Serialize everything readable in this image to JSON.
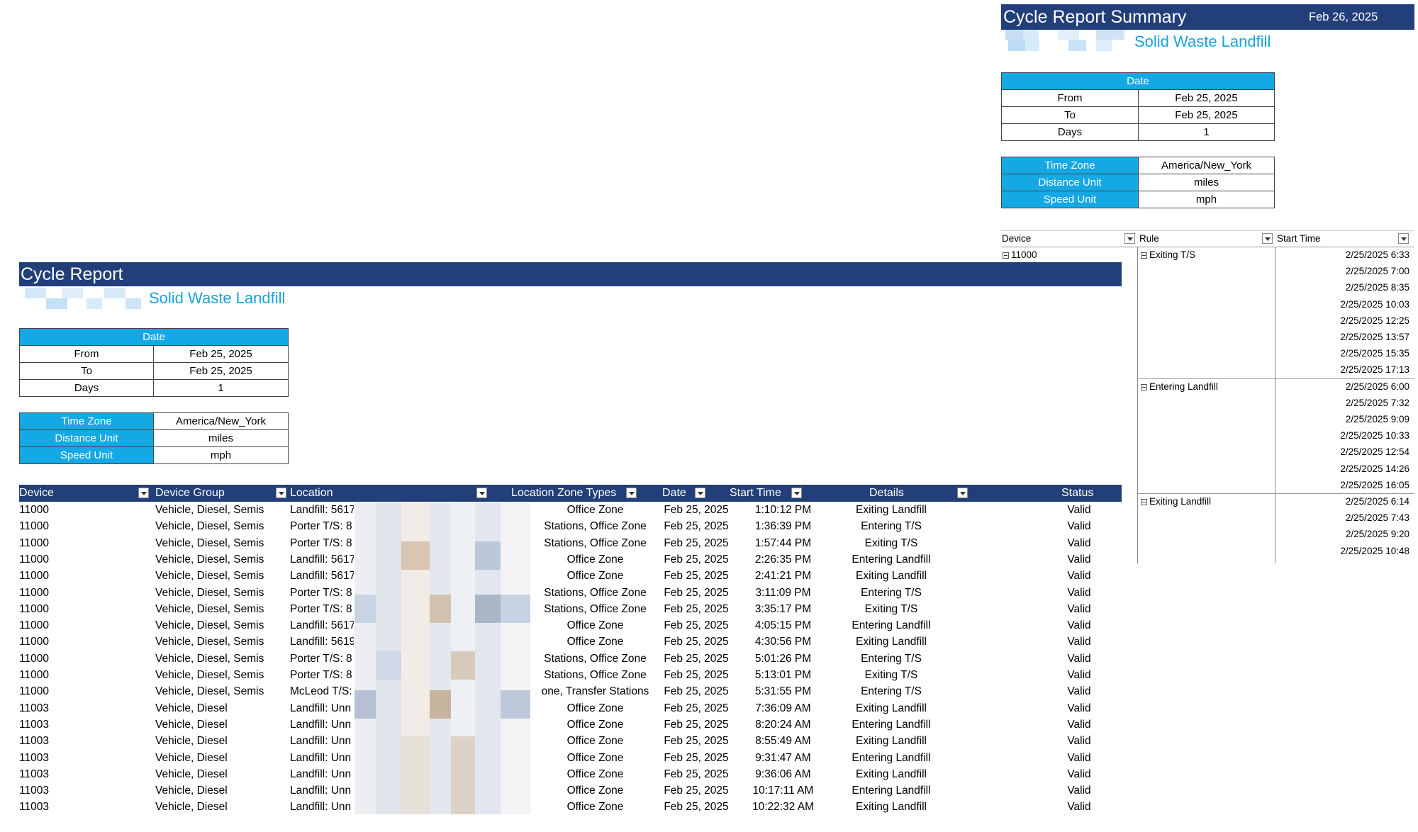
{
  "summary": {
    "title": "Cycle Report Summary",
    "date": "Feb 26, 2025",
    "subtitle": "Solid Waste Landfill",
    "date_header": "Date",
    "from_label": "From",
    "from_value": "Feb 25, 2025",
    "to_label": "To",
    "to_value": "Feb 25, 2025",
    "days_label": "Days",
    "days_value": "1",
    "tz_label": "Time Zone",
    "tz_value": "America/New_York",
    "dist_label": "Distance Unit",
    "dist_value": "miles",
    "speed_label": "Speed Unit",
    "speed_value": "mph"
  },
  "report": {
    "title": "Cycle Report",
    "subtitle": "Solid Waste Landfill",
    "date_header": "Date",
    "from_label": "From",
    "from_value": "Feb 25, 2025",
    "to_label": "To",
    "to_value": "Feb 25, 2025",
    "days_label": "Days",
    "days_value": "1",
    "tz_label": "Time Zone",
    "tz_value": "America/New_York",
    "dist_label": "Distance Unit",
    "dist_value": "miles",
    "speed_label": "Speed Unit",
    "speed_value": "mph"
  },
  "table": {
    "headers": [
      "Device",
      "Device Group",
      "Location",
      "Location Zone Types",
      "Date",
      "Start Time",
      "Details",
      "Status"
    ],
    "rows": [
      [
        "11000",
        "Vehicle, Diesel, Semis",
        "Landfill: 5617",
        "Office Zone",
        "Feb 25, 2025",
        "1:10:12 PM",
        "Exiting Landfill",
        "Valid"
      ],
      [
        "11000",
        "Vehicle, Diesel, Semis",
        "Porter T/S: 8",
        "Stations, Office Zone",
        "Feb 25, 2025",
        "1:36:39 PM",
        "Entering T/S",
        "Valid"
      ],
      [
        "11000",
        "Vehicle, Diesel, Semis",
        "Porter T/S: 8",
        "Stations, Office Zone",
        "Feb 25, 2025",
        "1:57:44 PM",
        "Exiting T/S",
        "Valid"
      ],
      [
        "11000",
        "Vehicle, Diesel, Semis",
        "Landfill: 5617",
        "Office Zone",
        "Feb 25, 2025",
        "2:26:35 PM",
        "Entering Landfill",
        "Valid"
      ],
      [
        "11000",
        "Vehicle, Diesel, Semis",
        "Landfill: 5617",
        "Office Zone",
        "Feb 25, 2025",
        "2:41:21 PM",
        "Exiting Landfill",
        "Valid"
      ],
      [
        "11000",
        "Vehicle, Diesel, Semis",
        "Porter T/S: 8",
        "Stations, Office Zone",
        "Feb 25, 2025",
        "3:11:09 PM",
        "Entering T/S",
        "Valid"
      ],
      [
        "11000",
        "Vehicle, Diesel, Semis",
        "Porter T/S: 8",
        "Stations, Office Zone",
        "Feb 25, 2025",
        "3:35:17 PM",
        "Exiting T/S",
        "Valid"
      ],
      [
        "11000",
        "Vehicle, Diesel, Semis",
        "Landfill: 5617",
        "Office Zone",
        "Feb 25, 2025",
        "4:05:15 PM",
        "Entering Landfill",
        "Valid"
      ],
      [
        "11000",
        "Vehicle, Diesel, Semis",
        "Landfill: 5619",
        "Office Zone",
        "Feb 25, 2025",
        "4:30:56 PM",
        "Exiting Landfill",
        "Valid"
      ],
      [
        "11000",
        "Vehicle, Diesel, Semis",
        "Porter T/S: 8",
        "Stations, Office Zone",
        "Feb 25, 2025",
        "5:01:26 PM",
        "Entering T/S",
        "Valid"
      ],
      [
        "11000",
        "Vehicle, Diesel, Semis",
        "Porter T/S: 8",
        "Stations, Office Zone",
        "Feb 25, 2025",
        "5:13:01 PM",
        "Exiting T/S",
        "Valid"
      ],
      [
        "11000",
        "Vehicle, Diesel, Semis",
        "McLeod T/S:",
        "one, Transfer Stations",
        "Feb 25, 2025",
        "5:31:55 PM",
        "Entering T/S",
        "Valid"
      ],
      [
        "11003",
        "Vehicle, Diesel",
        "Landfill: Unn",
        "Office Zone",
        "Feb 25, 2025",
        "7:36:09 AM",
        "Exiting Landfill",
        "Valid"
      ],
      [
        "11003",
        "Vehicle, Diesel",
        "Landfill: Unn",
        "Office Zone",
        "Feb 25, 2025",
        "8:20:24 AM",
        "Entering Landfill",
        "Valid"
      ],
      [
        "11003",
        "Vehicle, Diesel",
        "Landfill: Unn",
        "Office Zone",
        "Feb 25, 2025",
        "8:55:49 AM",
        "Exiting Landfill",
        "Valid"
      ],
      [
        "11003",
        "Vehicle, Diesel",
        "Landfill: Unn",
        "Office Zone",
        "Feb 25, 2025",
        "9:31:47 AM",
        "Entering Landfill",
        "Valid"
      ],
      [
        "11003",
        "Vehicle, Diesel",
        "Landfill: Unn",
        "Office Zone",
        "Feb 25, 2025",
        "9:36:06 AM",
        "Exiting Landfill",
        "Valid"
      ],
      [
        "11003",
        "Vehicle, Diesel",
        "Landfill: Unn",
        "Office Zone",
        "Feb 25, 2025",
        "10:17:11 AM",
        "Entering Landfill",
        "Valid"
      ],
      [
        "11003",
        "Vehicle, Diesel",
        "Landfill: Unn",
        "Office Zone",
        "Feb 25, 2025",
        "10:22:32 AM",
        "Exiting Landfill",
        "Valid"
      ]
    ]
  },
  "pivot": {
    "headers": [
      "Device",
      "Rule",
      "Start Time"
    ],
    "device": "11000",
    "groups": [
      {
        "rule": "Exiting T/S",
        "times": [
          "2/25/2025 6:33",
          "2/25/2025 7:00",
          "2/25/2025 8:35",
          "2/25/2025 10:03",
          "2/25/2025 12:25",
          "2/25/2025 13:57",
          "2/25/2025 15:35",
          "2/25/2025 17:13"
        ]
      },
      {
        "rule": "Entering Landfill",
        "times": [
          "2/25/2025 6:00",
          "2/25/2025 7:32",
          "2/25/2025 9:09",
          "2/25/2025 10:33",
          "2/25/2025 12:54",
          "2/25/2025 14:26",
          "2/25/2025 16:05"
        ]
      },
      {
        "rule": "Exiting Landfill",
        "times": [
          "2/25/2025 6:14",
          "2/25/2025 7:43",
          "2/25/2025 9:20",
          "2/25/2025 10:48"
        ]
      }
    ]
  },
  "colors": {
    "header_navy": "#223f79",
    "accent_cyan": "#14a8e4",
    "subtitle_blue": "#16a3dc"
  }
}
